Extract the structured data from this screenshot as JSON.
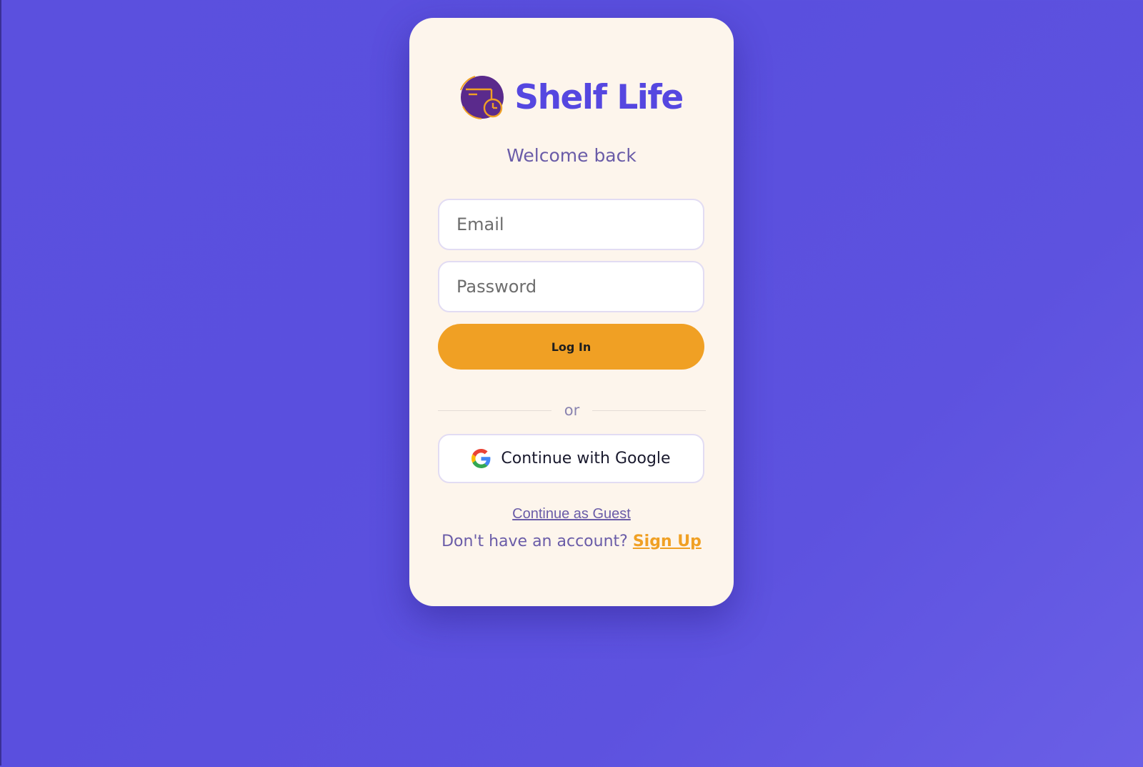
{
  "brand": {
    "name": "Shelf Life",
    "logo_icon": "shelf-clock-icon"
  },
  "welcome": "Welcome back",
  "form": {
    "email_placeholder": "Email",
    "password_placeholder": "Password",
    "login_label": "Log In",
    "divider_label": "or",
    "google_label": "Continue with Google",
    "google_icon": "google-g-icon",
    "guest_label": "Continue as Guest",
    "signup_prompt": "Don't have an account?",
    "signup_label": "Sign Up"
  },
  "colors": {
    "background": "#5b50de",
    "card": "#fdf5ec",
    "brand_text": "#5547e0",
    "primary_button": "#f0a024",
    "muted_text": "#6a5ca8",
    "logo_circle": "#5a2a8c",
    "logo_accent": "#f0a024"
  }
}
